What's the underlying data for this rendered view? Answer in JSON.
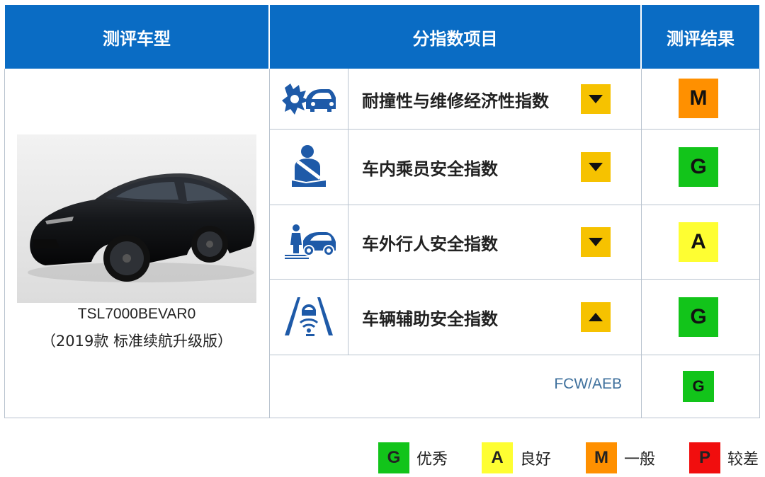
{
  "header": {
    "model_col": "测评车型",
    "items_col": "分指数项目",
    "result_col": "测评结果"
  },
  "vehicle": {
    "model_code": "TSL7000BEVAR0",
    "model_desc": "（2019款 标准续航升级版）"
  },
  "rows": [
    {
      "icon": "crash-repair-icon",
      "label": "耐撞性与维修经济性指数",
      "trend": "down",
      "grade": "M"
    },
    {
      "icon": "occupant-seatbelt-icon",
      "label": "车内乘员安全指数",
      "trend": "down",
      "grade": "G"
    },
    {
      "icon": "pedestrian-car-icon",
      "label": "车外行人安全指数",
      "trend": "down",
      "grade": "A"
    },
    {
      "icon": "driver-assist-icon",
      "label": "车辆辅助安全指数",
      "trend": "up",
      "grade": "G"
    }
  ],
  "sub_row": {
    "label": "FCW/AEB",
    "grade": "G"
  },
  "legend": [
    {
      "grade": "G",
      "text": "优秀"
    },
    {
      "grade": "A",
      "text": "良好"
    },
    {
      "grade": "M",
      "text": "一般"
    },
    {
      "grade": "P",
      "text": "较差"
    }
  ],
  "colors": {
    "header": "#0a6cc4",
    "G": "#12c41a",
    "A": "#fefe32",
    "M": "#ff9000",
    "P": "#f10e0e",
    "trend": "#f6c200",
    "sub_label": "#3d6f9c"
  }
}
